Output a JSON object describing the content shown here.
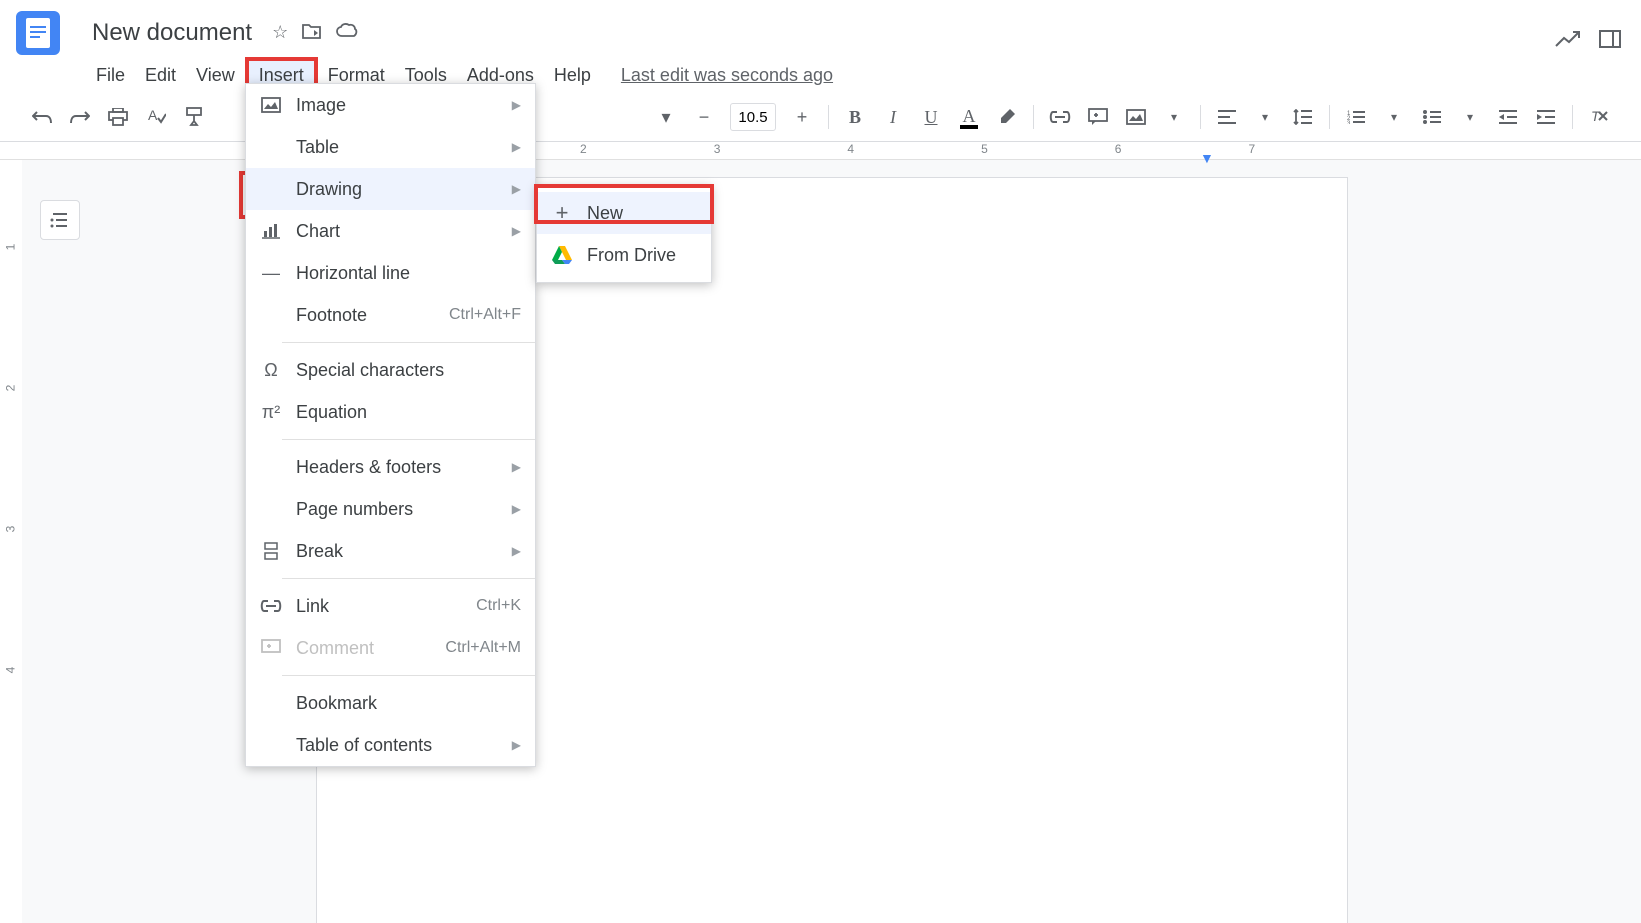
{
  "header": {
    "doc_title": "New document"
  },
  "menubar": {
    "items": [
      "File",
      "Edit",
      "View",
      "Insert",
      "Format",
      "Tools",
      "Add-ons",
      "Help"
    ],
    "last_edit": "Last edit was seconds ago"
  },
  "toolbar": {
    "font_size": "10.5"
  },
  "ruler_h": [
    "2",
    "3",
    "4",
    "5",
    "6",
    "7"
  ],
  "ruler_v": [
    "1",
    "2",
    "3",
    "4"
  ],
  "insert_menu": {
    "items": [
      {
        "icon": "image",
        "label": "Image",
        "arrow": true
      },
      {
        "icon": "table",
        "label": "Table",
        "arrow": true
      },
      {
        "icon": "drawing",
        "label": "Drawing",
        "arrow": true,
        "highlighted": true
      },
      {
        "icon": "chart",
        "label": "Chart",
        "arrow": true
      },
      {
        "icon": "hline",
        "label": "Horizontal line"
      },
      {
        "icon": "",
        "label": "Footnote",
        "shortcut": "Ctrl+Alt+F"
      },
      {
        "divider": true
      },
      {
        "icon": "omega",
        "label": "Special characters"
      },
      {
        "icon": "pi",
        "label": "Equation"
      },
      {
        "divider": true
      },
      {
        "icon": "",
        "label": "Headers & footers",
        "arrow": true
      },
      {
        "icon": "",
        "label": "Page numbers",
        "arrow": true
      },
      {
        "icon": "break",
        "label": "Break",
        "arrow": true
      },
      {
        "divider": true
      },
      {
        "icon": "link",
        "label": "Link",
        "shortcut": "Ctrl+K"
      },
      {
        "icon": "comment",
        "label": "Comment",
        "shortcut": "Ctrl+Alt+M",
        "disabled": true
      },
      {
        "divider": true
      },
      {
        "icon": "",
        "label": "Bookmark"
      },
      {
        "icon": "",
        "label": "Table of contents",
        "arrow": true
      }
    ]
  },
  "submenu": {
    "items": [
      {
        "icon": "plus",
        "label": "New",
        "highlighted": true
      },
      {
        "icon": "drive",
        "label": "From Drive"
      }
    ]
  }
}
